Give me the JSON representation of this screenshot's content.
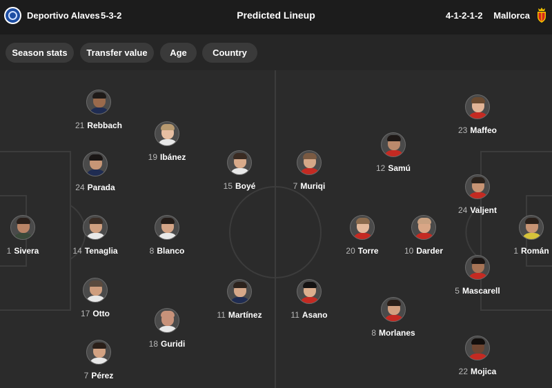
{
  "header": {
    "home_team": "Deportivo Alaves",
    "home_formation": "5-3-2",
    "title": "Predicted Lineup",
    "away_formation": "4-1-2-1-2",
    "away_team": "Mallorca"
  },
  "filters": [
    "Season stats",
    "Transfer value",
    "Age",
    "Country"
  ],
  "colors": {
    "background": "#1c1c1c",
    "pitch": "#2b2b2b",
    "chip": "#3a3a3a",
    "home_crest": "#1d4ea3",
    "away_crest": "#d6261c"
  },
  "home_players": [
    {
      "number": "21",
      "name": "Rebbach"
    },
    {
      "number": "19",
      "name": "Ibánez"
    },
    {
      "number": "24",
      "name": "Parada"
    },
    {
      "number": "15",
      "name": "Boyé"
    },
    {
      "number": "1",
      "name": "Sivera"
    },
    {
      "number": "14",
      "name": "Tenaglia"
    },
    {
      "number": "8",
      "name": "Blanco"
    },
    {
      "number": "17",
      "name": "Otto"
    },
    {
      "number": "11",
      "name": "Martínez"
    },
    {
      "number": "18",
      "name": "Guridi"
    },
    {
      "number": "7",
      "name": "Pérez"
    }
  ],
  "away_players": [
    {
      "number": "23",
      "name": "Maffeo"
    },
    {
      "number": "12",
      "name": "Samú"
    },
    {
      "number": "7",
      "name": "Muriqi"
    },
    {
      "number": "24",
      "name": "Valjent"
    },
    {
      "number": "20",
      "name": "Torre"
    },
    {
      "number": "10",
      "name": "Darder"
    },
    {
      "number": "1",
      "name": "Román"
    },
    {
      "number": "5",
      "name": "Mascarell"
    },
    {
      "number": "11",
      "name": "Asano"
    },
    {
      "number": "8",
      "name": "Morlanes"
    },
    {
      "number": "22",
      "name": "Mojica"
    }
  ]
}
